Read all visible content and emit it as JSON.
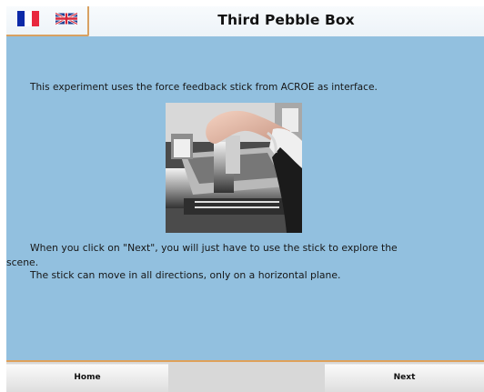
{
  "header": {
    "title": "Third Pebble Box"
  },
  "languages": [
    {
      "name": "French",
      "icon": "french-flag-icon"
    },
    {
      "name": "English",
      "icon": "uk-flag-icon"
    }
  ],
  "content": {
    "intro": "This experiment uses the force feedback stick from ACROE as interface.",
    "instruction_line_1": "When you click on \"Next\", you will just have to use the stick to explore the",
    "instruction_line_2": "scene.",
    "instruction_line_3": "The stick can move in all directions, only on a horizontal plane."
  },
  "footer": {
    "home_label": "Home",
    "next_label": "Next"
  },
  "colors": {
    "background": "#92c0df",
    "header": "#f3f8fb",
    "accent": "#dfa15a",
    "button": "#eeeeee"
  }
}
